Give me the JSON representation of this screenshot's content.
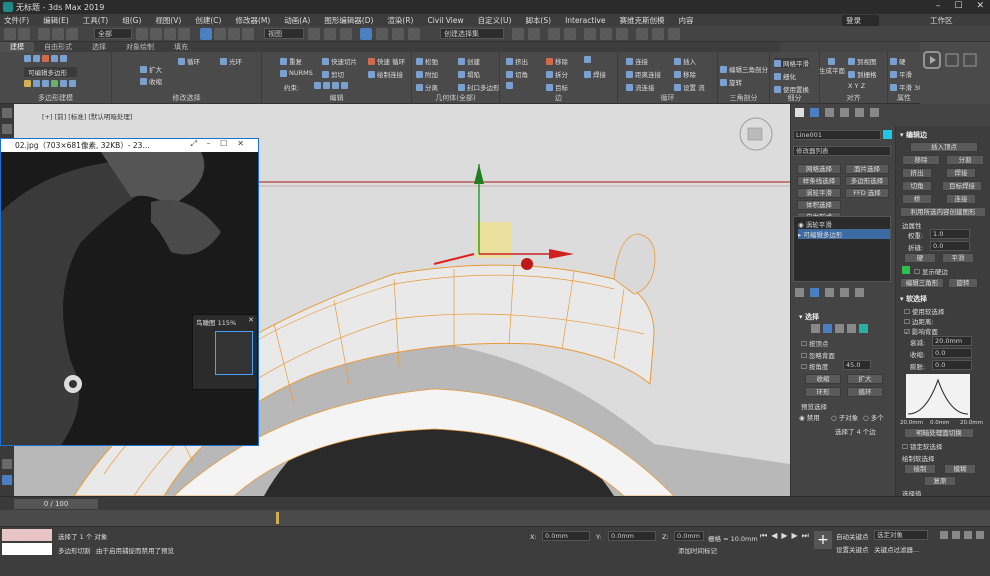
{
  "window": {
    "title": "无标题 - 3ds Max 2019"
  },
  "menu": [
    "文件(F)",
    "编辑(E)",
    "工具(T)",
    "组(G)",
    "视图(V)",
    "创建(C)",
    "修改器(M)",
    "动画(A)",
    "图形编辑器(D)",
    "渲染(R)",
    "Civil View",
    "自定义(U)",
    "脚本(S)",
    "Interactive",
    "赛维克斯创模",
    "内容"
  ],
  "user": "登录",
  "workspace": "工作区",
  "toolbar": {
    "filter": "全部",
    "view": "视图",
    "selection_set": "创建选择集"
  },
  "ribbon_tabs": [
    "建模",
    "自由形式",
    "选择",
    "对象绘制",
    "填充"
  ],
  "ribbon_groups": {
    "polygon_modeling": "多边形建模",
    "modify_selection": "修改选择",
    "edit": "编辑",
    "geometry": "几何体(全部)",
    "edge": "边",
    "loop": "循环",
    "tris": "三角剖分",
    "subdivision": "细分",
    "align": "对齐",
    "properties": "属性"
  },
  "ribbon_items": {
    "editable_poly": "可编辑多边形",
    "grow": "扩大",
    "shrink": "收缩",
    "loop": "循环",
    "ring": "光环",
    "repeat": "重复",
    "quickslice": "快速切片",
    "quickloop": "快速 循环",
    "nurms": "NURMS",
    "cut": "剪切",
    "paint_connect": "绘制连接",
    "constrain": "约束:",
    "relax": "松弛",
    "create": "创建",
    "attach": "附加",
    "collapse": "塌陷",
    "detach": "分离",
    "cap_poly": "封口多边形",
    "extrude": "挤出",
    "remove": "移除",
    "chamfer": "切角",
    "split": "拆分",
    "weld": "焊接",
    "target": "目标",
    "connect": "连接",
    "distance_connect": "距离连接",
    "flow_connect": "流连接",
    "insert": "插入",
    "remove2": "移除",
    "set_flow": "设置 流",
    "edit_tris": "编辑三角剖分",
    "rotate": "旋转",
    "mesh_smooth": "网格平滑",
    "tessellate": "细化",
    "use_displace": "使用置换",
    "gen_plane": "生成平面",
    "to_view": "到视图",
    "to_grid": "到栅格",
    "x": "X",
    "y": "Y",
    "z": "Z",
    "hard": "硬",
    "smooth": "平滑",
    "smooth30": "平滑 30"
  },
  "viewport": {
    "label": "[+] [前] [标准] [默认明暗处理]"
  },
  "image_window": {
    "title": "02.jpg（703×681像素, 32KB）- 23...",
    "navigator_title": "鸟瞰图 115%"
  },
  "command_panel": {
    "object_name": "Line001",
    "modifier_list": "修改器列表",
    "buttons": [
      "网格选择",
      "面片选择",
      "样条线选择",
      "多边形选择",
      "涡轮平滑",
      "FFD 选择",
      "体积选择",
      "自由形式"
    ],
    "stack": [
      "涡轮平滑",
      "可编辑多边形"
    ],
    "selection_head": "选择",
    "by_vertex": "按顶点",
    "ignore_backfacing": "忽略背面",
    "by_angle": "按角度",
    "angle_value": "45.0",
    "shrink": "收缩",
    "grow": "扩大",
    "ring": "环形",
    "loop": "循环",
    "preview_selection": "预览选择",
    "disabled": "禁用",
    "subobject": "子对象",
    "multi": "多个",
    "selected_info": "选择了 4 个边"
  },
  "right_panel": {
    "edit_edges": "编辑边",
    "insert_vertex": "插入顶点",
    "remove": "移除",
    "split": "分割",
    "extrude": "挤出",
    "weld": "焊接",
    "chamfer": "切角",
    "target_weld": "目标焊接",
    "bridge": "桥",
    "connect": "连接",
    "create_shape": "利用所选内容创建图形",
    "edge_props": "边属性",
    "weight": "权重:",
    "weight_val": "1.0",
    "crease": "折缝:",
    "crease_val": "0.0",
    "hard": "硬",
    "smooth": "平滑",
    "show_hard_edges": "显示硬边",
    "edit_tris": "编辑三角形",
    "rotate": "旋转",
    "soft_selection": "软选择",
    "use_soft": "使用软选择",
    "edge_distance": "边距离:",
    "affect_backfacing": "影响背面",
    "falloff": "衰减:",
    "falloff_val": "20.0mm",
    "pinch": "收缩:",
    "pinch_val": "0.0",
    "bubble": "膨胀:",
    "bubble_val": "0.0",
    "curve_left": "20.0mm",
    "curve_mid": "0.0mm",
    "curve_right": "20.0mm",
    "shaded_face": "明暗处理面切换",
    "lock_soft": "锁定软选择",
    "paint_soft": "绘制软选择",
    "paint": "绘制",
    "blur": "模糊",
    "revert": "复原",
    "select_value": "选择值"
  },
  "timeline": {
    "frame": "0 / 100"
  },
  "status": {
    "selected": "选择了 1 个 对象",
    "hint": "由于启用捕捉而禁用了预览",
    "mode": "多边形切割",
    "x_val": "0.0mm",
    "y_val": "0.0mm",
    "z_val": "0.0mm",
    "grid": "栅格 = 10.0mm",
    "add_time_tag": "添加时间标记",
    "auto_key": "自动关键点",
    "set_key": "设置关键点",
    "selected_obj": "选定对象",
    "key_filter": "关键点过滤器..."
  },
  "colors": {
    "accent_blue": "#4a7fc1",
    "edge_orange": "#e89a3a",
    "viewport_bg": "#d6d6d6"
  }
}
